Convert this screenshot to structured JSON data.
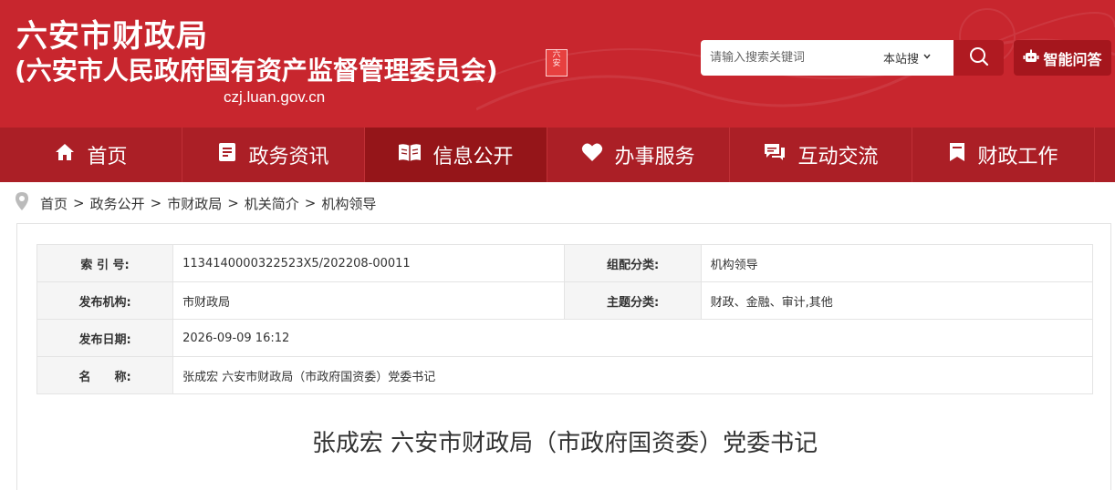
{
  "header": {
    "title": "六安市财政局",
    "subtitle": "(六安市人民政府国有资产监督管理委员会)",
    "domain": "czj.luan.gov.cn",
    "seal_text": "六安",
    "brand_color": "#c8262e"
  },
  "search": {
    "placeholder": "请输入搜索关键词",
    "scope": "本站搜",
    "scope_icon": "chevron-down-icon",
    "button_icon": "search-icon",
    "ai_label": "智能问答",
    "ai_icon": "robot-icon"
  },
  "nav": {
    "items": [
      {
        "label": "首页",
        "icon": "home-icon"
      },
      {
        "label": "政务资讯",
        "icon": "document-icon"
      },
      {
        "label": "信息公开",
        "icon": "open-book-icon"
      },
      {
        "label": "办事服务",
        "icon": "heart-icon"
      },
      {
        "label": "互动交流",
        "icon": "chat-icon"
      },
      {
        "label": "财政工作",
        "icon": "bookmark-icon"
      }
    ],
    "active_index": 2
  },
  "breadcrumb": {
    "icon": "location-pin-icon",
    "items": [
      "首页",
      "政务公开",
      "市财政局",
      "机关简介",
      "机构领导"
    ],
    "separator": ">"
  },
  "meta": {
    "index_label": "索 引 号:",
    "index_value": "1134140000322523X5/202208-00011",
    "category_label": "组配分类:",
    "category_value": "机构领导",
    "publisher_label": "发布机构:",
    "publisher_value": "市财政局",
    "topic_label": "主题分类:",
    "topic_value": "财政、金融、审计,其他",
    "date_label": "发布日期:",
    "date_value": "2026-09-09 16:12",
    "name_label": "名　　称:",
    "name_value": "张成宏 六安市财政局（市政府国资委）党委书记"
  },
  "article": {
    "title": "张成宏  六安市财政局（市政府国资委）党委书记"
  }
}
